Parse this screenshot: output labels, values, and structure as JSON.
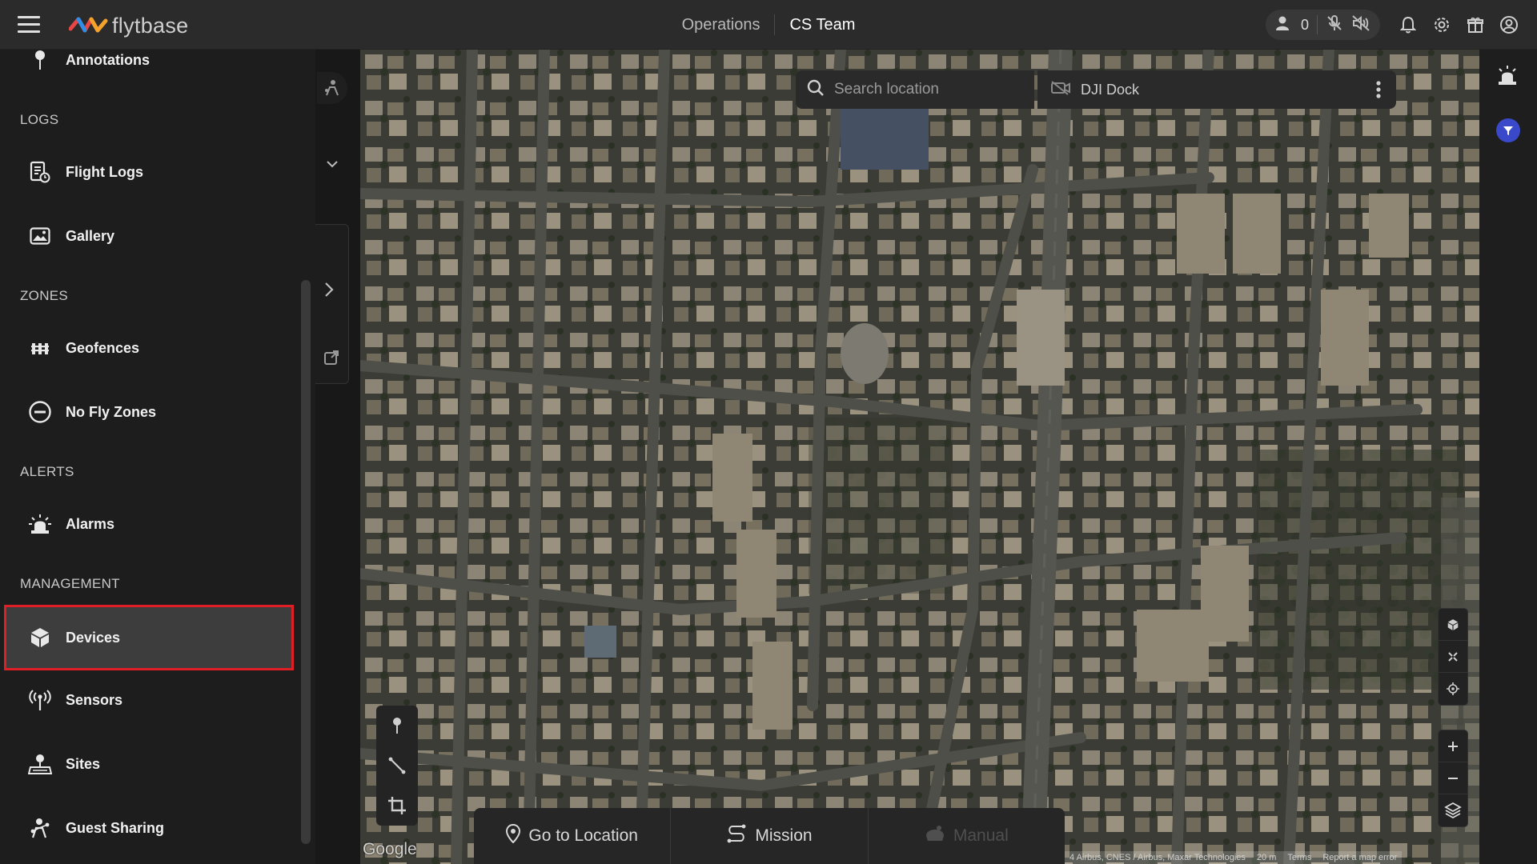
{
  "header": {
    "logo_text": "flytbase",
    "nav_operations": "Operations",
    "nav_team": "CS Team",
    "user_count": "0"
  },
  "sidebar": {
    "top_item": {
      "label": "Annotations",
      "icon": "pin-icon"
    },
    "sections": {
      "logs": "LOGS",
      "zones": "ZONES",
      "alerts": "ALERTS",
      "management": "MANAGEMENT"
    },
    "items": {
      "flight_logs": {
        "label": "Flight Logs",
        "icon": "flight-log-icon"
      },
      "gallery": {
        "label": "Gallery",
        "icon": "gallery-icon"
      },
      "geofences": {
        "label": "Geofences",
        "icon": "geofence-icon"
      },
      "no_fly_zones": {
        "label": "No Fly Zones",
        "icon": "no-entry-icon"
      },
      "alarms": {
        "label": "Alarms",
        "icon": "siren-icon"
      },
      "devices": {
        "label": "Devices",
        "icon": "cube-icon",
        "selected": true
      },
      "sensors": {
        "label": "Sensors",
        "icon": "antenna-icon"
      },
      "sites": {
        "label": "Sites",
        "icon": "site-icon"
      },
      "guest_sharing": {
        "label": "Guest Sharing",
        "icon": "share-user-icon"
      }
    }
  },
  "map": {
    "search_placeholder": "Search location",
    "dock_name": "DJI Dock",
    "google_label": "Google",
    "attribution": "4 Airbus, CNES / Airbus, Maxar Technologies",
    "scale": "20 m",
    "terms": "Terms",
    "report": "Report a map error"
  },
  "bottom_bar": {
    "go_to_location": "Go to Location",
    "mission": "Mission",
    "manual": "Manual"
  },
  "colors": {
    "selection_outline": "#e01e25",
    "filter_badge": "#3a49c9"
  }
}
